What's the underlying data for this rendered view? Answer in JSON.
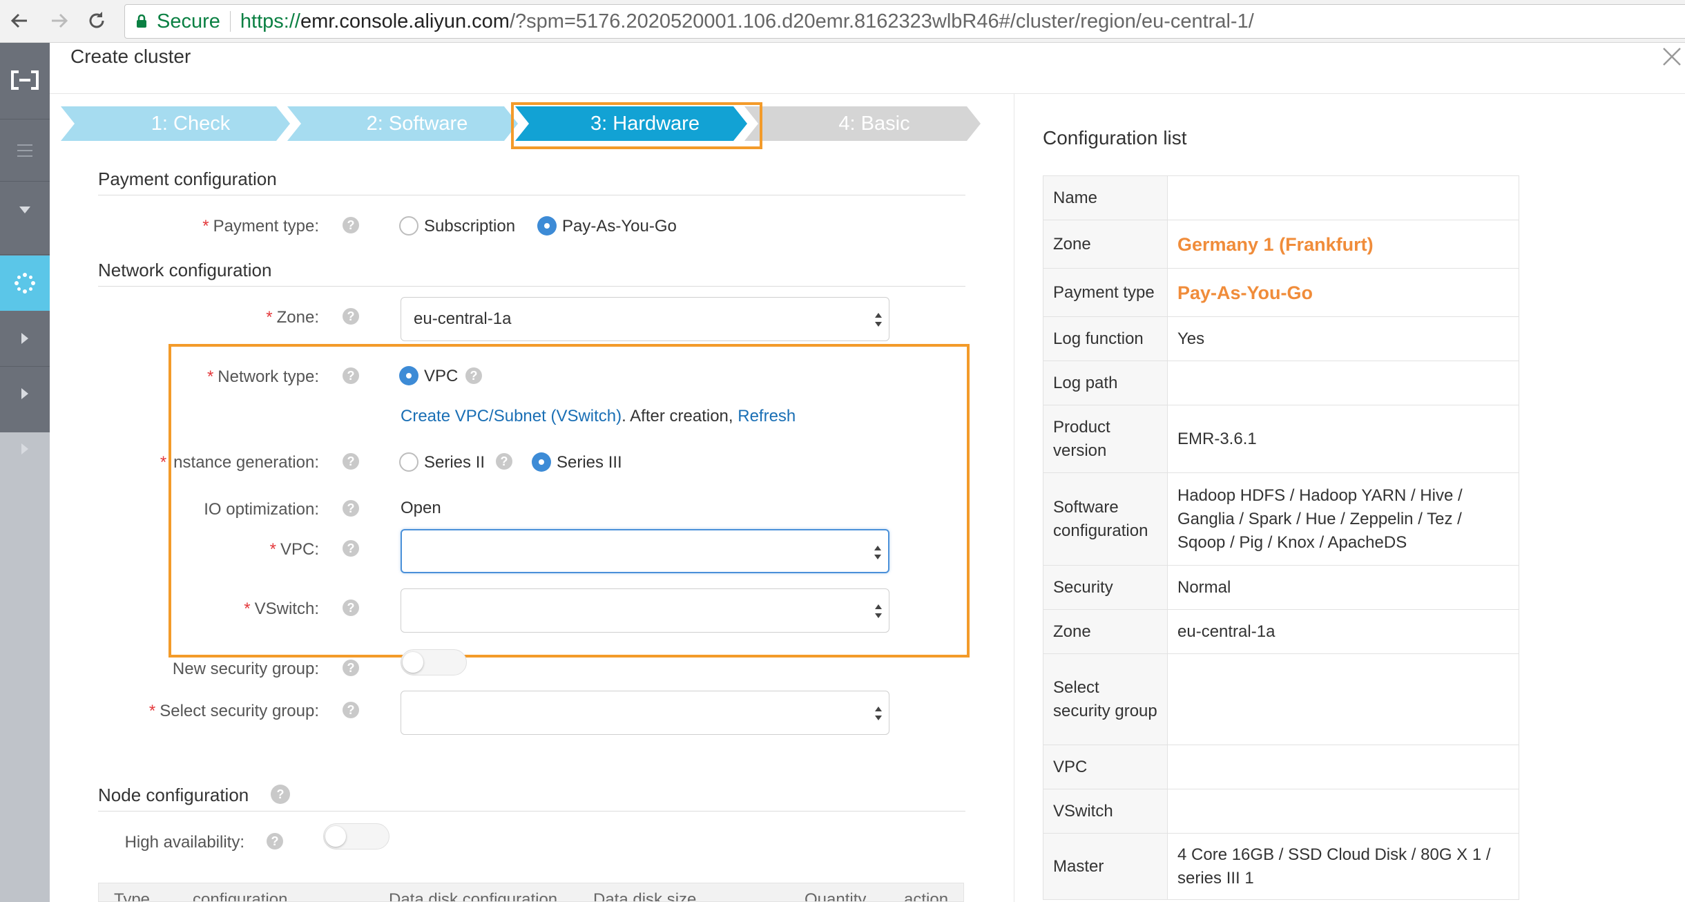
{
  "browser": {
    "secure_label": "Secure",
    "url_scheme": "https://",
    "url_host": "emr.console.aliyun.com",
    "url_rest": "/?spm=5176.2020520001.106.d20emr.8162323wlbR46#/cluster/region/eu-central-1/"
  },
  "modal": {
    "title": "Create cluster"
  },
  "steps": [
    {
      "label": "1:  Check",
      "state": "done"
    },
    {
      "label": "2:  Software",
      "state": "done"
    },
    {
      "label": "3:  Hardware",
      "state": "active"
    },
    {
      "label": "4:  Basic",
      "state": "todo"
    }
  ],
  "colors": {
    "step_done": "#a6dcf0",
    "step_active": "#12a2d4",
    "step_todo": "#d5d5d5",
    "highlight": "#f39b2a",
    "accent_value": "#f08c3a",
    "link": "#1a6fb5"
  },
  "payment": {
    "section_title": "Payment configuration",
    "type_label": "Payment type:",
    "options": [
      "Subscription",
      "Pay-As-You-Go"
    ],
    "selected": "Pay-As-You-Go"
  },
  "network": {
    "section_title": "Network configuration",
    "zone_label": "Zone:",
    "zone_value": "eu-central-1a",
    "network_type_label": "Network type:",
    "network_type_option": "VPC",
    "create_link": "Create VPC/Subnet (VSwitch)",
    "after_creation": ". After creation, ",
    "refresh_link": "Refresh",
    "instance_gen_label": "nstance generation:",
    "instance_gen_options": [
      "Series II",
      "Series III"
    ],
    "instance_gen_selected": "Series III",
    "io_label": "IO optimization:",
    "io_value": "Open",
    "vpc_label": "VPC:",
    "vpc_value": "",
    "vswitch_label": "VSwitch:",
    "vswitch_value": "",
    "new_sg_label": "New security group:",
    "select_sg_label": "Select security group:",
    "select_sg_value": ""
  },
  "node": {
    "section_title": "Node configuration",
    "ha_label": "High availability:",
    "table_headers": [
      "Type",
      "configuration",
      "Data disk configuration",
      "Data disk size",
      "Quantity",
      "action"
    ]
  },
  "config_list": {
    "title": "Configuration list",
    "rows": [
      {
        "key": "Name",
        "value": ""
      },
      {
        "key": "Zone",
        "value": "Germany 1 (Frankfurt)",
        "highlight": true
      },
      {
        "key": "Payment type",
        "value": "Pay-As-You-Go",
        "highlight": true
      },
      {
        "key": "Log function",
        "value": "Yes"
      },
      {
        "key": "Log path",
        "value": ""
      },
      {
        "key": "Product version",
        "value": "EMR-3.6.1"
      },
      {
        "key": "Software configuration",
        "value": "Hadoop HDFS / Hadoop YARN / Hive / Ganglia / Spark / Hue / Zeppelin / Tez / Sqoop / Pig / Knox / ApacheDS"
      },
      {
        "key": "Security",
        "value": "Normal"
      },
      {
        "key": "Zone",
        "value": "eu-central-1a"
      },
      {
        "key": "Select security group",
        "value": ""
      },
      {
        "key": "VPC",
        "value": ""
      },
      {
        "key": "VSwitch",
        "value": ""
      },
      {
        "key": "Master",
        "value": "4 Core 16GB / SSD Cloud Disk / 80G X 1 / series III 1"
      }
    ]
  }
}
